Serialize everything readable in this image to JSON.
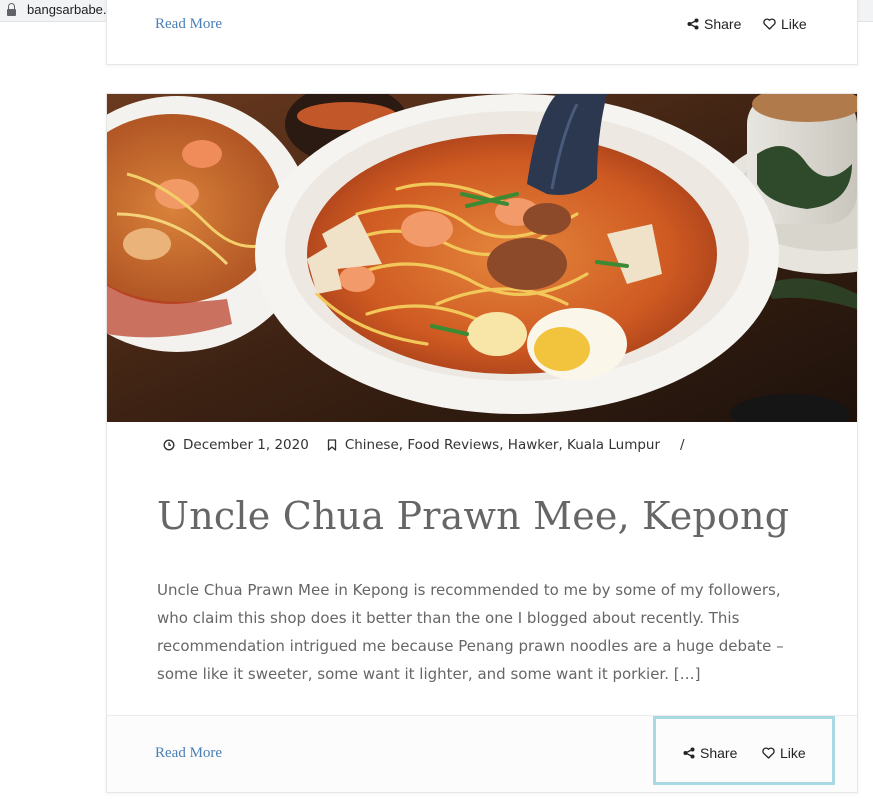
{
  "browser": {
    "url": "bangsarbabe.com"
  },
  "previous_post": {
    "read_more": "Read More",
    "share": "Share",
    "like": "Like"
  },
  "post": {
    "date": "December 1, 2020",
    "categories": "Chinese, Food Reviews, Hawker, Kuala Lumpur",
    "separator": "/",
    "title": "Uncle Chua Prawn Mee, Kepong",
    "excerpt": "Uncle Chua Prawn Mee in Kepong is recommended to me by some of my followers, who claim this shop does it better than the one I blogged about recently. This recommendation intrigued me because Penang prawn noodles are a huge debate – some like it sweeter, some want it lighter, and some want it porkier. […]",
    "read_more": "Read More",
    "share": "Share",
    "like": "Like"
  },
  "colors": {
    "link": "#4a7fb5",
    "highlight_border": "#a8d8e2"
  }
}
